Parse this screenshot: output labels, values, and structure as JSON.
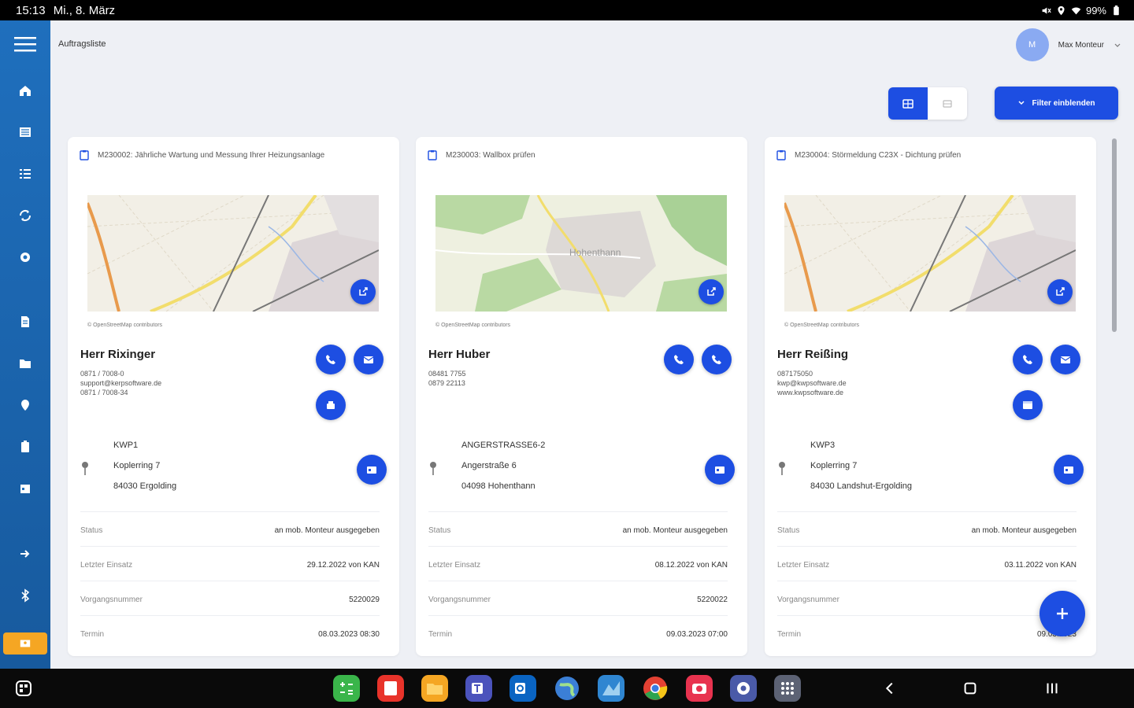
{
  "status_bar": {
    "time": "15:13",
    "date": "Mi., 8. März",
    "battery": "99%"
  },
  "header": {
    "title": "Auftragsliste",
    "avatar_initial": "M",
    "user_name": "Max Monteur"
  },
  "toolbar": {
    "filter_label": "Filter einblenden"
  },
  "fab": {
    "label": "+"
  },
  "field_labels": {
    "status": "Status",
    "last_use": "Letzter Einsatz",
    "process_no": "Vorgangsnummer",
    "appointment": "Termin"
  },
  "map_attribution": "© OpenStreetMap contributors",
  "cards": [
    {
      "title": "M230002: Jährliche Wartung und Messung Ihrer Heizungsanlage",
      "contact_name": "Herr Rixinger",
      "contact_lines": [
        "0871 / 7008-0",
        "support@kerpsoftware.de",
        "0871 / 7008-34"
      ],
      "address": {
        "label": "KWP1",
        "street": "Koplerring 7",
        "city": "84030 Ergolding"
      },
      "status": "an mob. Monteur ausgegeben",
      "last_use": "29.12.2022 von KAN",
      "process_no": "5220029",
      "appointment": "08.03.2023 08:30"
    },
    {
      "title": "M230003: Wallbox prüfen",
      "contact_name": "Herr Huber",
      "contact_lines": [
        "08481 7755",
        "0879 22113"
      ],
      "address": {
        "label": "ANGERSTRASSE6-2",
        "street": "Angerstraße 6",
        "city": "04098 Hohenthann"
      },
      "map_place": "Hohenthann",
      "status": "an mob. Monteur ausgegeben",
      "last_use": "08.12.2022 von KAN",
      "process_no": "5220022",
      "appointment": "09.03.2023 07:00"
    },
    {
      "title": "M230004: Störmeldung C23X - Dichtung prüfen",
      "contact_name": "Herr Reißing",
      "contact_lines": [
        "087175050",
        "kwp@kwpsoftware.de",
        "www.kwpsoftware.de"
      ],
      "address": {
        "label": "KWP3",
        "street": "Koplerring 7",
        "city": "84030 Landshut-Ergolding"
      },
      "status": "an mob. Monteur ausgegeben",
      "last_use": "03.11.2022 von KAN",
      "process_no": "",
      "appointment": "09.03.2023"
    }
  ],
  "colors": {
    "primary": "#1d4ee2",
    "sidebar": "#1f6fbd",
    "accent": "#f5a623"
  }
}
